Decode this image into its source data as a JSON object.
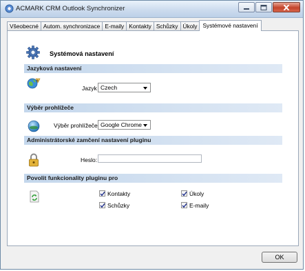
{
  "window": {
    "title": "ACMARK CRM Outlook Synchronizer"
  },
  "tabs": [
    {
      "label": "Všeobecné",
      "active": false
    },
    {
      "label": "Autom. synchronizace",
      "active": false
    },
    {
      "label": "E-maily",
      "active": false
    },
    {
      "label": "Kontakty",
      "active": false
    },
    {
      "label": "Schůzky",
      "active": false
    },
    {
      "label": "Úkoly",
      "active": false
    },
    {
      "label": "Systémové nastavení",
      "active": true
    }
  ],
  "page": {
    "heading": "Systémová nastavení"
  },
  "language": {
    "section": "Jazyková nastavení",
    "label": "Jazyk",
    "value": "Czech"
  },
  "browser": {
    "section": "Výběr prohlížeče",
    "label": "Výběr prohlížeče",
    "value": "Google Chrome"
  },
  "lock": {
    "section": "Administrátorské zamčení nastavení pluginu",
    "password_label": "Heslo:",
    "password_value": ""
  },
  "features": {
    "section": "Povolit funkcionality pluginu pro",
    "items": [
      {
        "label": "Kontakty",
        "checked": true
      },
      {
        "label": "Úkoly",
        "checked": true
      },
      {
        "label": "Schůzky",
        "checked": true
      },
      {
        "label": "E-maily",
        "checked": true
      }
    ]
  },
  "footer": {
    "ok_label": "OK"
  },
  "colors": {
    "section_bg": "#c4d7ec",
    "accent": "#3b7bc8"
  }
}
